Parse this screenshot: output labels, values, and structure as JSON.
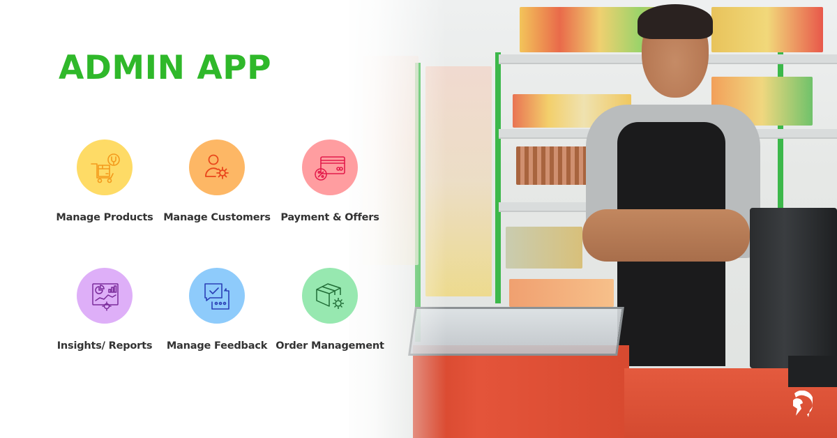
{
  "title": "ADMIN APP",
  "colors": {
    "title": "#2fb82a",
    "label_text": "#333333"
  },
  "features": [
    {
      "label": "Manage Products",
      "icon": "cart-wrench-icon",
      "bg": "#fedb66",
      "stroke": "#f39a1c"
    },
    {
      "label": "Manage Customers",
      "icon": "user-gear-icon",
      "bg": "#fdb765",
      "stroke": "#e9461b"
    },
    {
      "label": "Payment & Offers",
      "icon": "card-discount-icon",
      "bg": "#ff9da0",
      "stroke": "#e31b4b"
    },
    {
      "label": "Insights/ Reports",
      "icon": "report-chart-gear-icon",
      "bg": "#deaff8",
      "stroke": "#7a2b9a"
    },
    {
      "label": "Manage Feedback",
      "icon": "chat-check-icon",
      "bg": "#8ecbfb",
      "stroke": "#2a3fb6"
    },
    {
      "label": "Order Management",
      "icon": "box-gear-icon",
      "bg": "#97e8b0",
      "stroke": "#1f6b35"
    }
  ],
  "photo": {
    "description": "smiling-shopkeeper-at-counter"
  },
  "logo": {
    "icon": "spartan-helmet-logo-icon",
    "color": "#ffffff"
  }
}
